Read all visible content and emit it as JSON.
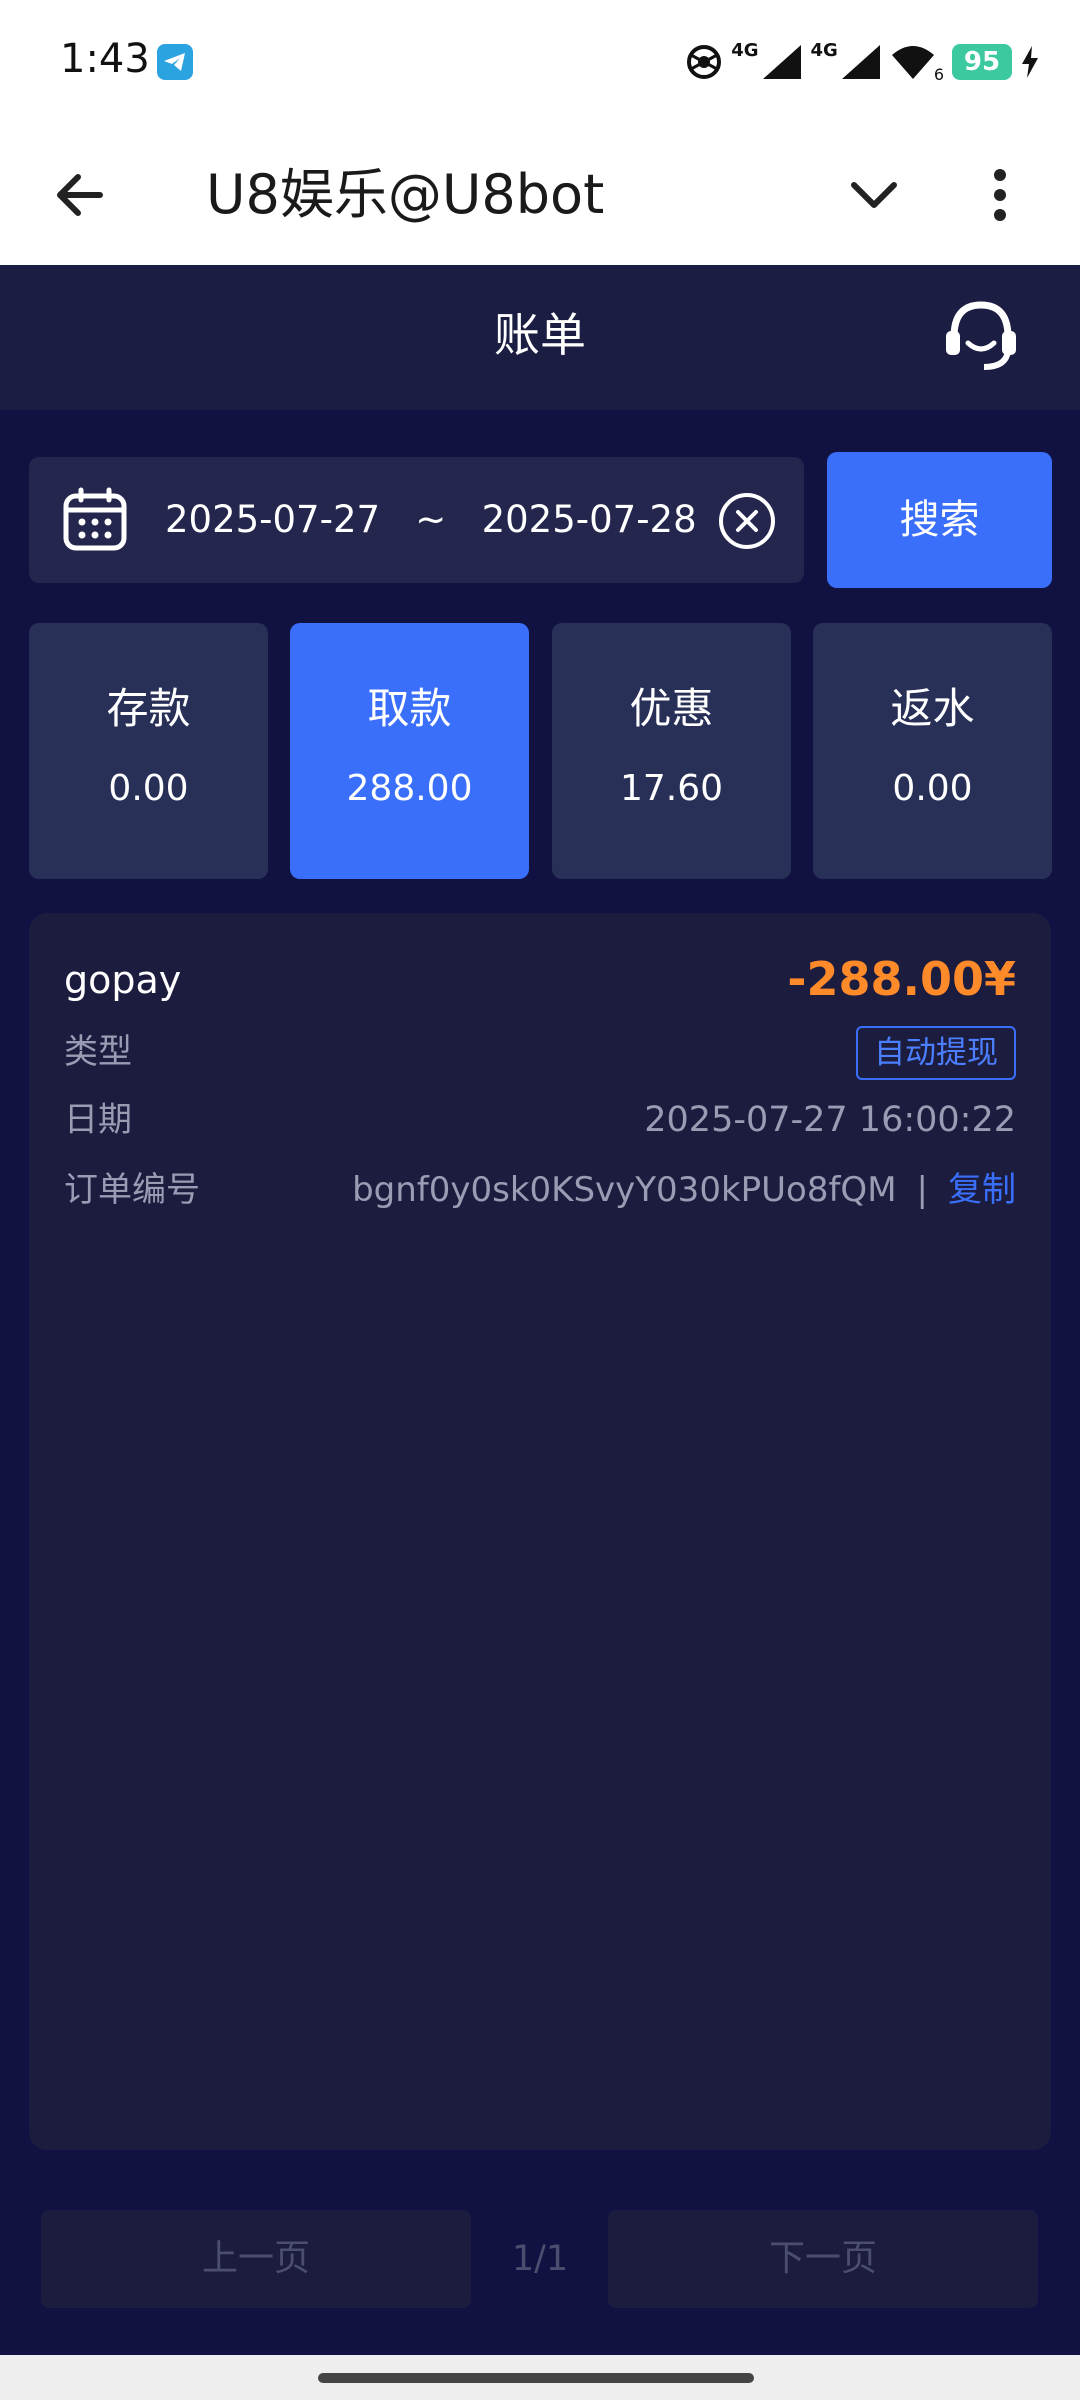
{
  "status_bar": {
    "time": "1:43",
    "network_1": "4G",
    "network_2": "4G",
    "wifi_sub": "6",
    "battery": "95"
  },
  "app_bar": {
    "title": "U8娱乐@U8bot",
    "icons": [
      "back-arrow-icon",
      "chevron-down-icon",
      "more-vert-icon"
    ]
  },
  "page": {
    "title": "账单",
    "support_icon": "headset-icon"
  },
  "filter": {
    "date_range": "2025-07-27   ~   2025-07-28",
    "search_label": "搜索"
  },
  "tabs": [
    {
      "label": "存款",
      "value": "0.00",
      "active": false
    },
    {
      "label": "取款",
      "value": "288.00",
      "active": true
    },
    {
      "label": "优惠",
      "value": "17.60",
      "active": false
    },
    {
      "label": "返水",
      "value": "0.00",
      "active": false
    }
  ],
  "record": {
    "method": "gopay",
    "amount": "-288.00¥",
    "type_label": "类型",
    "type_value": "自动提现",
    "date_label": "日期",
    "date_value": "2025-07-27 16:00:22",
    "order_label": "订单编号",
    "order_value": "bgnf0y0sk0KSvyY030kPUo8fQM",
    "separator": "|",
    "copy_label": "复制"
  },
  "pager": {
    "prev_label": "上一页",
    "info": "1/1",
    "next_label": "下一页"
  },
  "colors": {
    "accent": "#3a6ffb",
    "amount": "#ff8a2a",
    "card_bg": "#1c1c3e",
    "page_bg": "#111242"
  }
}
